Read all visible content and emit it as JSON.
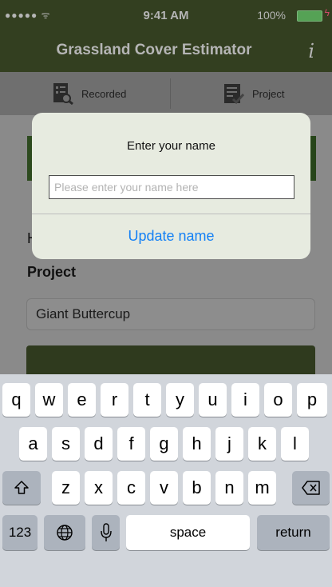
{
  "status_bar": {
    "signal": "●●●●● ᯤ",
    "time": "9:41 AM",
    "battery_percent": "100%",
    "battery_level": 1.0,
    "charging_icon": "bolt-icon"
  },
  "header": {
    "title": "Grassland Cover Estimator",
    "info_label": "i"
  },
  "tabs": [
    {
      "label": "Recorded",
      "icon": "recorded-list-icon"
    },
    {
      "label": "Project",
      "icon": "project-checklist-icon"
    }
  ],
  "form": {
    "hidden_label_prefix": "H",
    "project_label": "Project",
    "project_value": "Giant Buttercup"
  },
  "alert": {
    "title": "Enter your name",
    "placeholder": "Please enter your name here",
    "button": "Update name"
  },
  "keyboard": {
    "row1": [
      "q",
      "w",
      "e",
      "r",
      "t",
      "y",
      "u",
      "i",
      "o",
      "p"
    ],
    "row2": [
      "a",
      "s",
      "d",
      "f",
      "g",
      "h",
      "j",
      "k",
      "l"
    ],
    "row3": [
      "z",
      "x",
      "c",
      "v",
      "b",
      "n",
      "m"
    ],
    "numbers_key": "123",
    "space_key": "space",
    "return_key": "return",
    "shift_icon": "shift-icon",
    "backspace_icon": "backspace-icon",
    "globe_icon": "globe-icon",
    "mic_icon": "microphone-icon"
  }
}
